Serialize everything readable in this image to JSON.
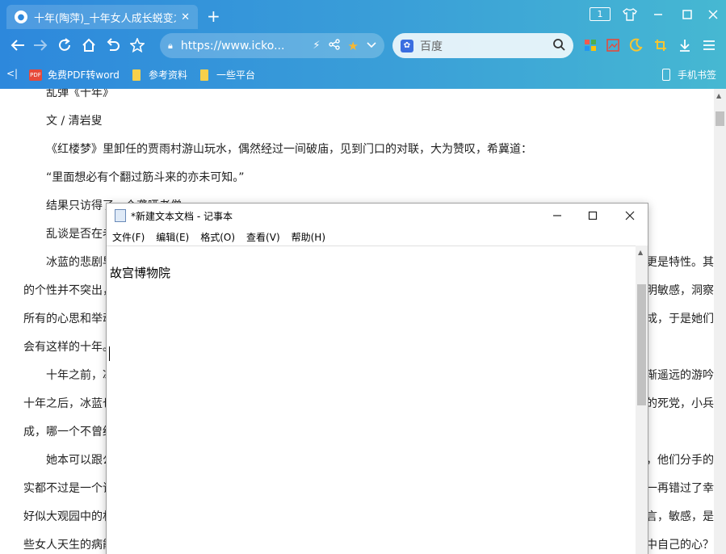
{
  "browser": {
    "tab_title": "十年(陶萍)_十年女人成长蜕变之",
    "tab_close": "✕",
    "new_tab": "+",
    "window_badge": "1",
    "url": "https://www.icko...",
    "search_placeholder": "百度",
    "bookmarks": [
      {
        "label": "免费PDF转word"
      },
      {
        "label": "参考资料"
      },
      {
        "label": "一些平台"
      }
    ],
    "mobile_bookmarks": "手机书签",
    "bookmark_left": "<|",
    "pdf_icon_text": "PDF"
  },
  "article": {
    "lines": [
      "乱弹《十年》",
      "文 / 清岩叟",
      "《红楼梦》里卸任的贾雨村游山玩水，偶然经过一间破庙，见到门口的对联，大为赞叹，希冀道：",
      "“里面想必有个翻过筋斗来的亦未可知。”",
      "结果只访得了一个聋哑老僧。",
      "乱谈是否在老",
      "冰蓝的悲剧早",
      "的个性并不突出，",
      "所有的心思和举动",
      "会有这样的十年。",
      "十年之前，冰",
      "十年之后，冰蓝也",
      "成，哪一个不曾经",
      "她本可以跟公",
      "实都不过是一个该",
      "好似大观园中的林",
      "些女人天生的病能"
    ],
    "right_fragments": [
      "更是特性。其",
      "明敏感，洞察",
      "成，于是她们",
      "渐遥远的游吟",
      "的死党，小兵",
      "，他们分手的",
      "一再错过了幸",
      "言，敏感，是",
      "中自己的心？"
    ]
  },
  "notepad": {
    "title": "*新建文本文档 - 记事本",
    "menu": [
      "文件(F)",
      "编辑(E)",
      "格式(O)",
      "查看(V)",
      "帮助(H)"
    ],
    "content": "故宫博物院"
  }
}
